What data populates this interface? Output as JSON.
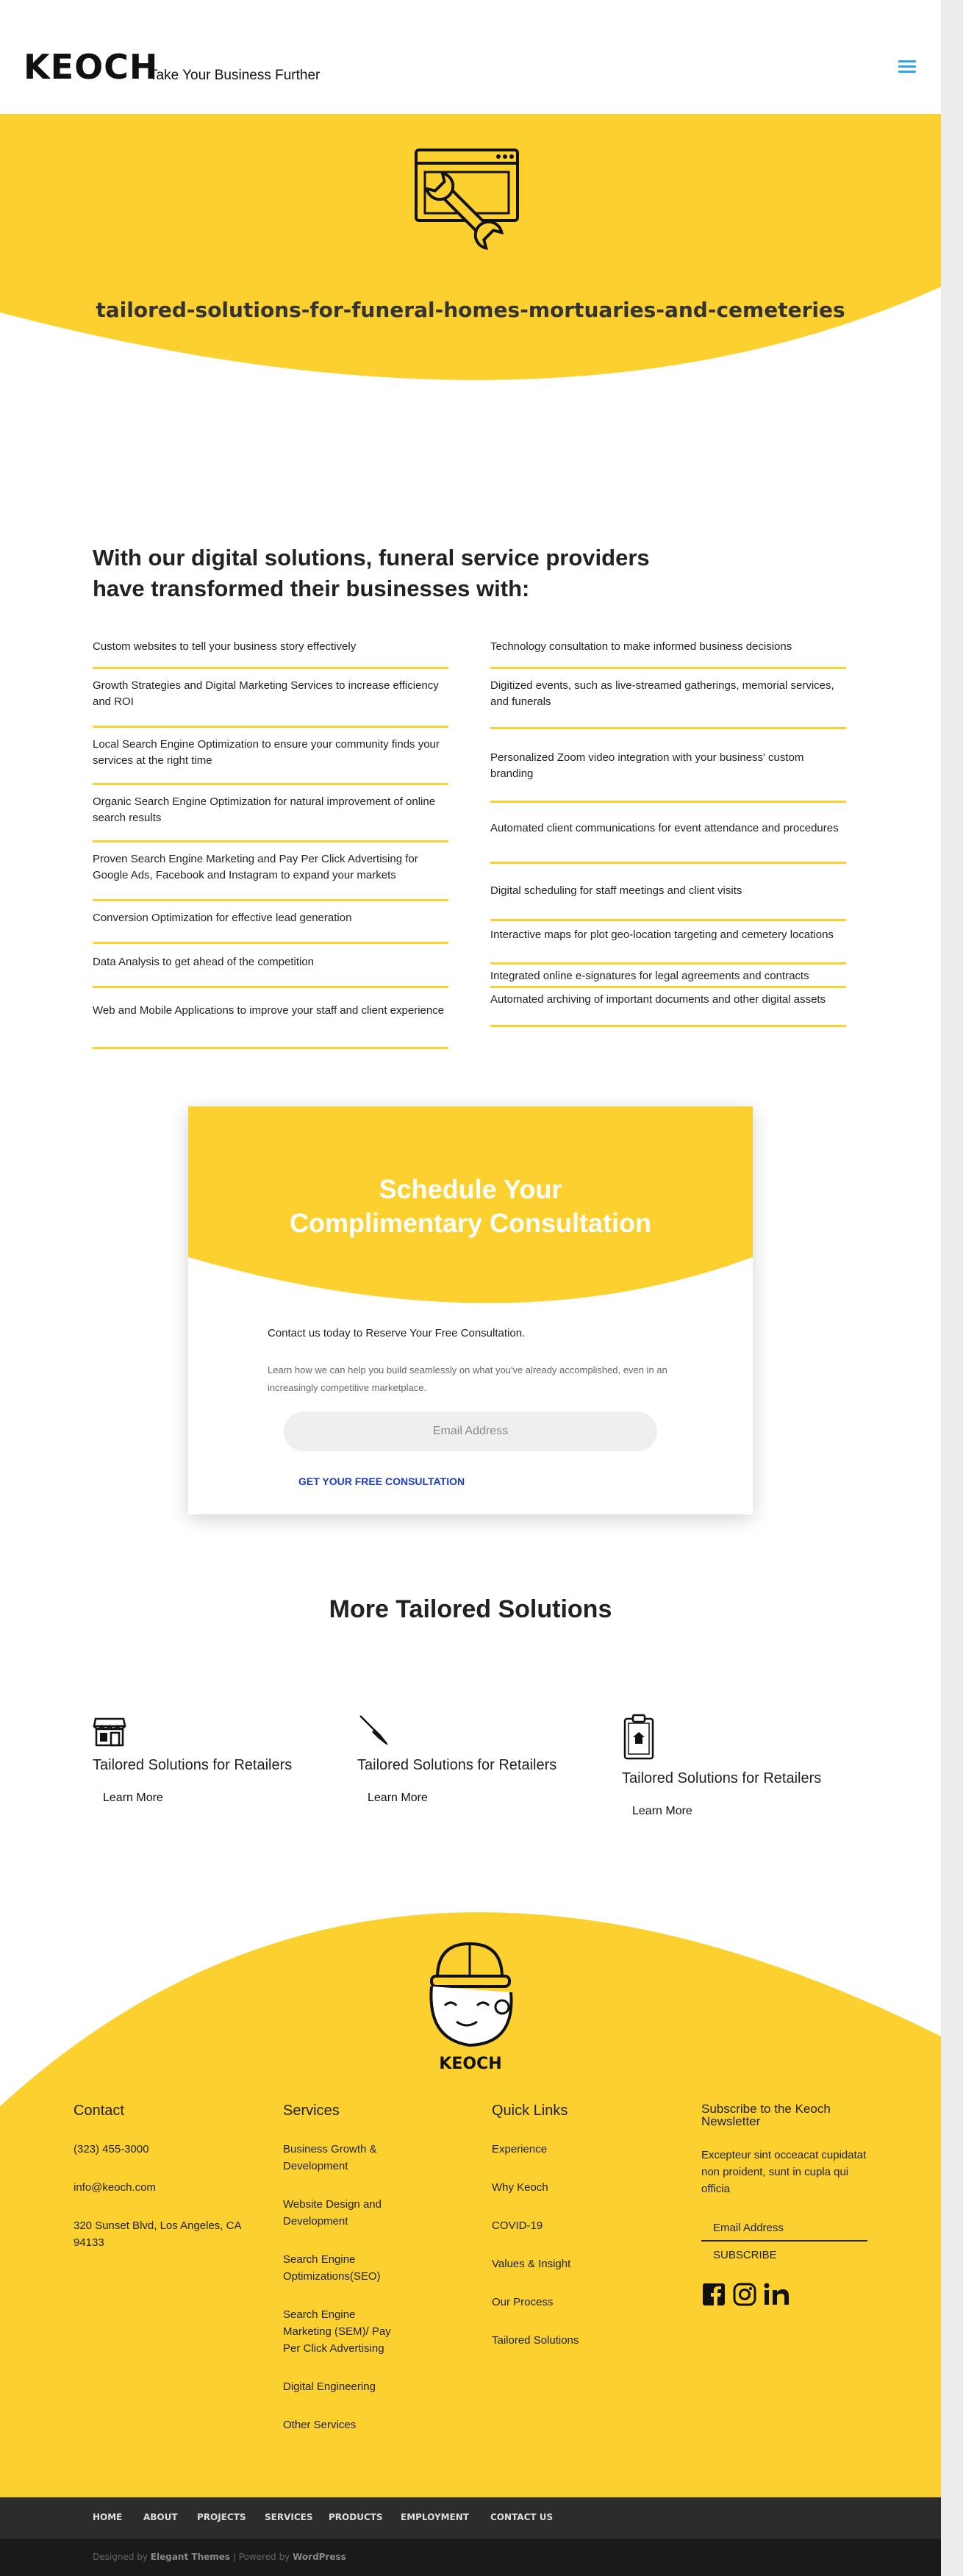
{
  "colors": {
    "accent": "#fcd12f",
    "link": "#1d3fbd",
    "menu": "#2ea3f2",
    "footer_bar": "#2c2c2c",
    "credits_bar": "#1a1a1a"
  },
  "header": {
    "logo": "KEOCH",
    "tagline": "Take Your Business Further",
    "menu_icon": "hamburger-menu-icon"
  },
  "hero": {
    "icon": "browser-wrench-icon",
    "title": "tailored-solutions-for-funeral-homes-mortuaries-and-cemeteries"
  },
  "transform": {
    "heading": "With our digital solutions, funeral service providers have transformed their businesses with:",
    "left_items": [
      "Custom websites to tell your business story effectively",
      "Growth Strategies and Digital Marketing Services to increase efficiency and ROI",
      "Local Search Engine Optimization to ensure your community finds your services at the right time",
      "Organic Search Engine Optimization for natural improvement of online search results",
      "Proven Search Engine Marketing and Pay Per Click Advertising for Google Ads, Facebook and Instagram to expand your markets",
      "Conversion Optimization for effective lead generation",
      "Data Analysis to get ahead of the competition",
      "Web and Mobile Applications to improve your staff and client experience"
    ],
    "right_items": [
      "Technology consultation to make informed business decisions",
      "Digitized events, such as live-streamed gatherings, memorial services, and funerals",
      "Personalized Zoom video integration with your business' custom branding",
      "Automated client communications for event attendance and procedures",
      "Digital scheduling for staff meetings and client visits",
      "Interactive maps for plot geo-location targeting and cemetery locations",
      "Integrated online e-signatures for legal agreements and contracts",
      "Automated archiving of important documents and other digital assets"
    ]
  },
  "consultation": {
    "title_line1": "Schedule Your",
    "title_line2": "Complimentary Consultation",
    "lead": "Contact us today to Reserve Your Free Consultation.",
    "text": "Learn how we can help you build seamlessly on what you've already accomplished, even in an increasingly competitive marketplace.",
    "email_placeholder": "Email Address",
    "cta": "GET YOUR FREE CONSULTATION"
  },
  "more": {
    "title": "More Tailored Solutions",
    "cards": [
      {
        "icon": "storefront-icon",
        "title": "Tailored Solutions for Retailers",
        "link": "Learn More"
      },
      {
        "icon": "paintbrush-icon",
        "title": "Tailored Solutions for Retailers",
        "link": "Learn More"
      },
      {
        "icon": "clipboard-icon",
        "title": "Tailored Solutions for Retailers",
        "link": "Learn More"
      }
    ]
  },
  "footer": {
    "mascot_label": "KEOCH",
    "contact": {
      "heading": "Contact",
      "phone": "(323) 455-3000",
      "email": "info@keoch.com",
      "address": "320 Sunset Blvd, Los Angeles, CA 94133"
    },
    "services": {
      "heading": "Services",
      "items": [
        "Business Growth & Development",
        "Website Design and Development",
        "Search Engine Optimizations(SEO)",
        "Search Engine Marketing (SEM)/ Pay Per Click Advertising",
        "Digital Engineering",
        "Other Services"
      ]
    },
    "quick_links": {
      "heading": "Quick Links",
      "items": [
        "Experience",
        "Why Keoch",
        "COVID-19",
        "Values & Insight",
        "Our Process",
        "Tailored Solutions"
      ]
    },
    "newsletter": {
      "heading": "Subscribe to the Keoch Newsletter",
      "text": "Excepteur sint occeacat cupidatat non proident, sunt in cupla qui officia",
      "email_placeholder": "Email Address",
      "button": "SUBSCRIBE",
      "socials": [
        "facebook-icon",
        "instagram-icon",
        "linkedin-icon"
      ]
    }
  },
  "bottom_nav": [
    "HOME",
    "ABOUT",
    "PROJECTS",
    "SERVICES",
    "PRODUCTS",
    "EMPLOYMENT",
    "CONTACT US"
  ],
  "credits": {
    "prefix": "Designed by",
    "designer": "Elegant Themes",
    "middle": "| Powered by",
    "platform": "WordPress"
  }
}
